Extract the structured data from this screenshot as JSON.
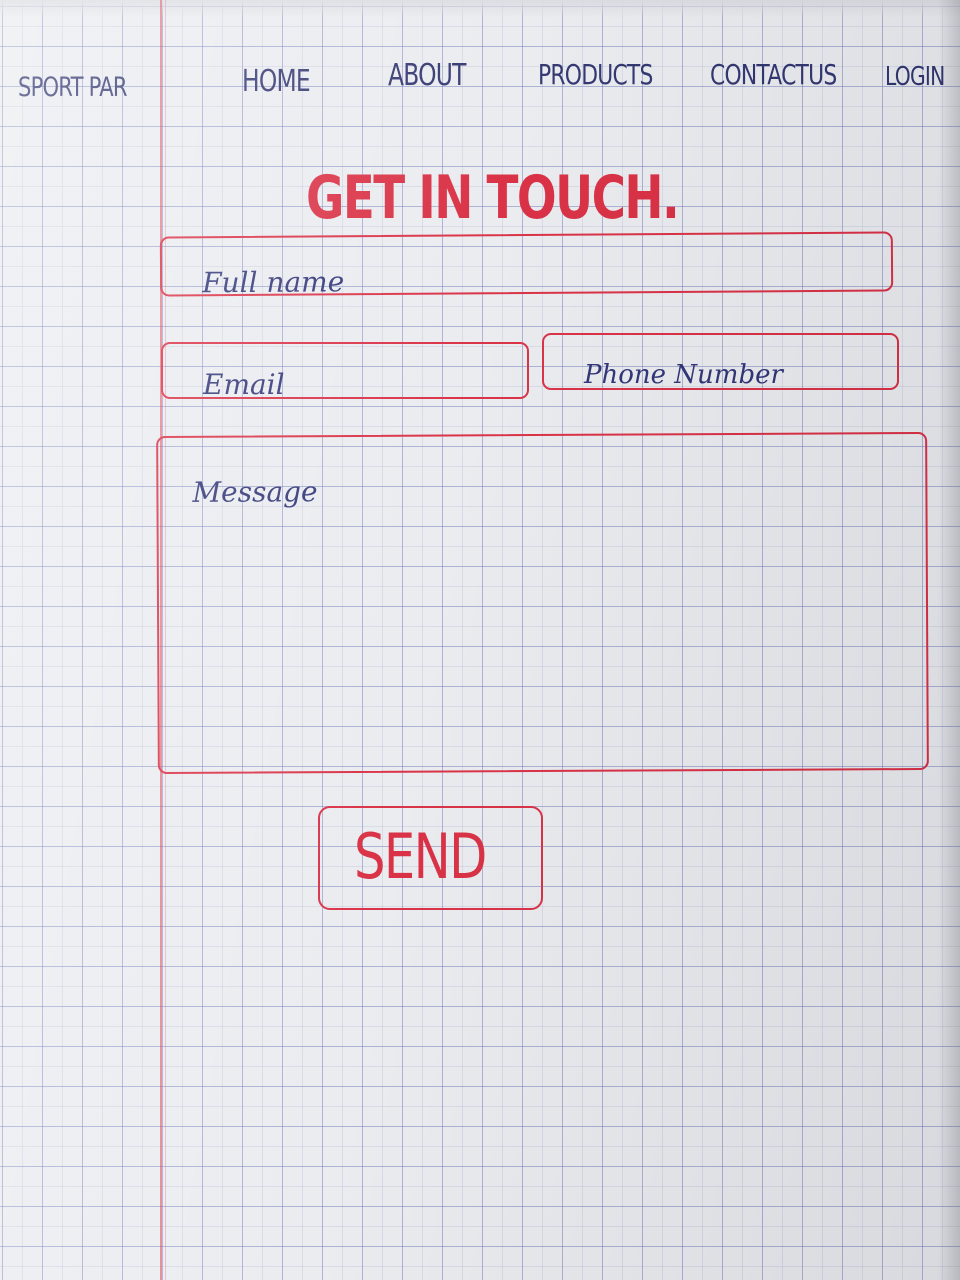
{
  "nav": {
    "brand": "SPORT PAR",
    "items": [
      {
        "label": "HOME"
      },
      {
        "label": "ABOUT"
      },
      {
        "label": "PRODUCTS"
      },
      {
        "label": "CONTACTUS"
      },
      {
        "label": "LOGIN"
      }
    ]
  },
  "contact_form": {
    "title": "GET IN TOUCH.",
    "full_name_placeholder": "Full name",
    "email_placeholder": "Email",
    "phone_placeholder": "Phone Number",
    "message_placeholder": "Message",
    "send_label": "SEND"
  },
  "colors": {
    "ink_blue": "#2a2e72",
    "ink_red": "#d9293f",
    "paper": "#e9ebef"
  }
}
